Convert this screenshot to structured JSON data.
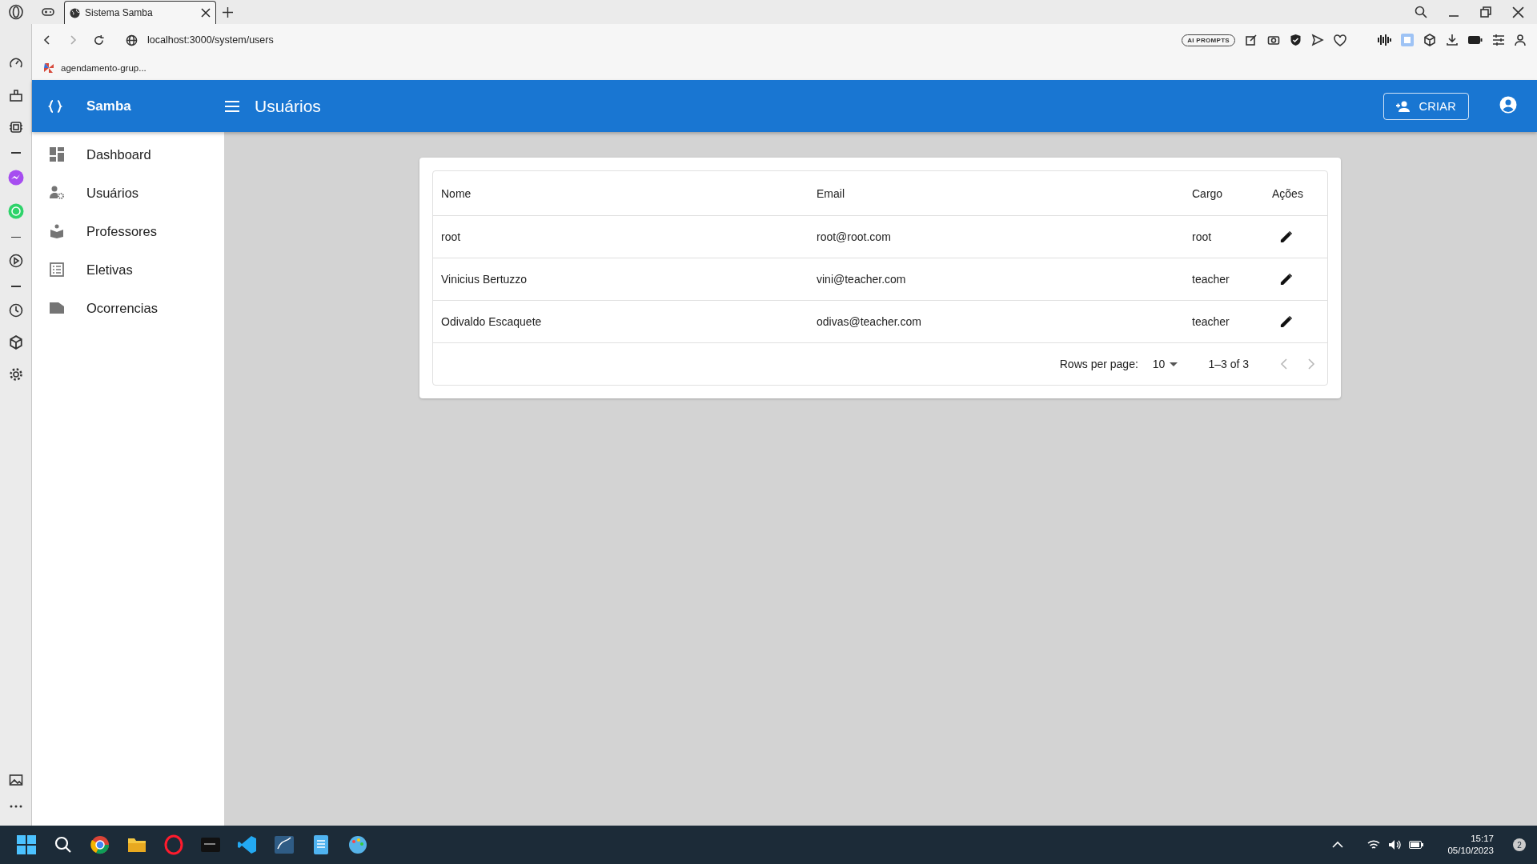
{
  "browser": {
    "tab_title": "Sistema Samba",
    "url": "localhost:3000/system/users",
    "bookmark": "agendamento-grup...",
    "ai_button": "AI PROMPTS"
  },
  "app": {
    "brand": "Samba",
    "title": "Usuários",
    "create_button": "CRIAR"
  },
  "nav": [
    {
      "label": "Dashboard",
      "kind": "dashboard"
    },
    {
      "label": "Usuários",
      "kind": "users"
    },
    {
      "label": "Professores",
      "kind": "teachers"
    },
    {
      "label": "Eletivas",
      "kind": "list"
    },
    {
      "label": "Ocorrencias",
      "kind": "folder"
    }
  ],
  "table": {
    "columns": [
      "Nome",
      "Email",
      "Cargo",
      "Ações"
    ],
    "rows": [
      [
        "root",
        "root@root.com",
        "root"
      ],
      [
        "Vinicius Bertuzzo",
        "vini@teacher.com",
        "teacher"
      ],
      [
        "Odivaldo Escaquete",
        "odivas@teacher.com",
        "teacher"
      ]
    ],
    "pagination": {
      "rows_label": "Rows per page:",
      "rows_value": "10",
      "range": "1–3 of 3",
      "prev_disabled": true,
      "next_disabled": true
    }
  },
  "taskbar": {
    "time": "15:17",
    "date": "05/10/2023",
    "notifications": "2"
  }
}
